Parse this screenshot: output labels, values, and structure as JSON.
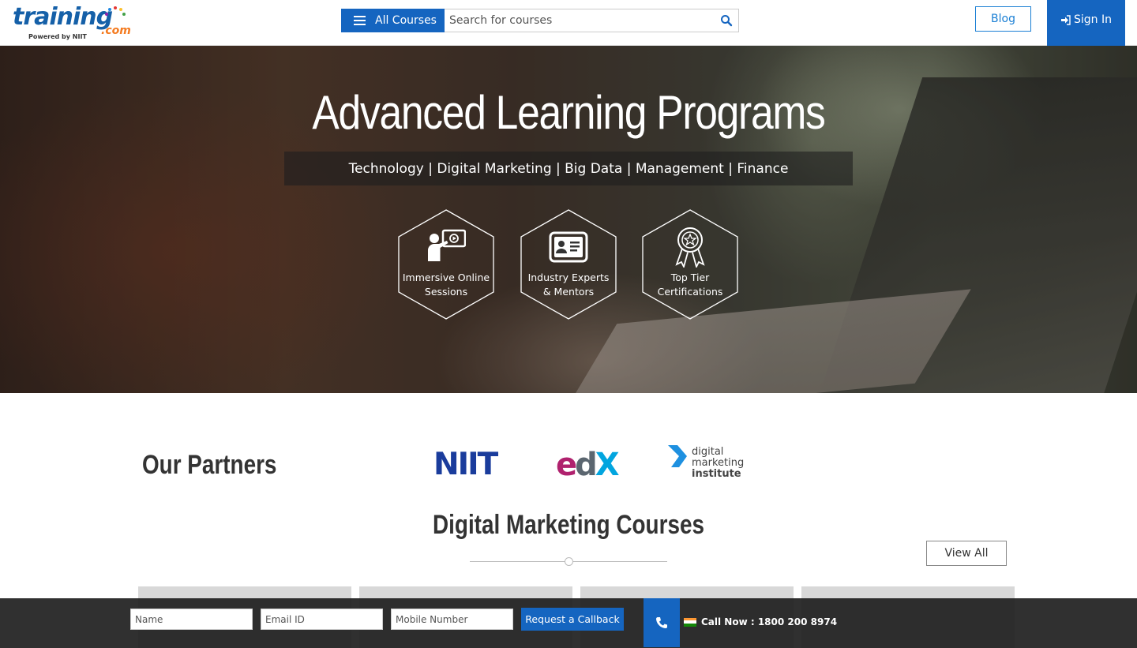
{
  "header": {
    "logo": {
      "main": "training",
      "suffix": ".com",
      "tagline": "Powered by NIIT"
    },
    "all_courses_label": "All Courses",
    "search_placeholder": "Search for courses",
    "blog_label": "Blog",
    "signin_label": "Sign In"
  },
  "hero": {
    "title": "Advanced Learning Programs",
    "subtitle": "Technology | Digital Marketing | Big Data | Management | Finance",
    "features": [
      {
        "icon": "presenter-icon",
        "line1": "Immersive Online",
        "line2": "Sessions"
      },
      {
        "icon": "id-card-icon",
        "line1": "Industry Experts",
        "line2": "& Mentors"
      },
      {
        "icon": "award-ribbon-icon",
        "line1": "Top Tier",
        "line2": "Certifications"
      }
    ]
  },
  "partners": {
    "title": "Our Partners",
    "logos": {
      "niit": "NIIT",
      "edx_e": "e",
      "edx_d": "d",
      "edx_x": "X",
      "dmi_line1": "digital",
      "dmi_line2": "marketing",
      "dmi_line3": "institute"
    }
  },
  "section": {
    "title": "Digital Marketing Courses",
    "view_all_label": "View All"
  },
  "callback": {
    "name_placeholder": "Name",
    "email_placeholder": "Email ID",
    "mobile_placeholder": "Mobile Number",
    "button_label": "Request a Callback",
    "call_now": "Call Now : 1800 200 8974"
  },
  "colors": {
    "brand_blue": "#1565c0",
    "link_blue": "#1a7fd4",
    "logo_orange": "#f47b20",
    "niit_blue": "#1a3c9c",
    "edx_magenta": "#b0216e",
    "edx_cyan": "#02a5df"
  }
}
